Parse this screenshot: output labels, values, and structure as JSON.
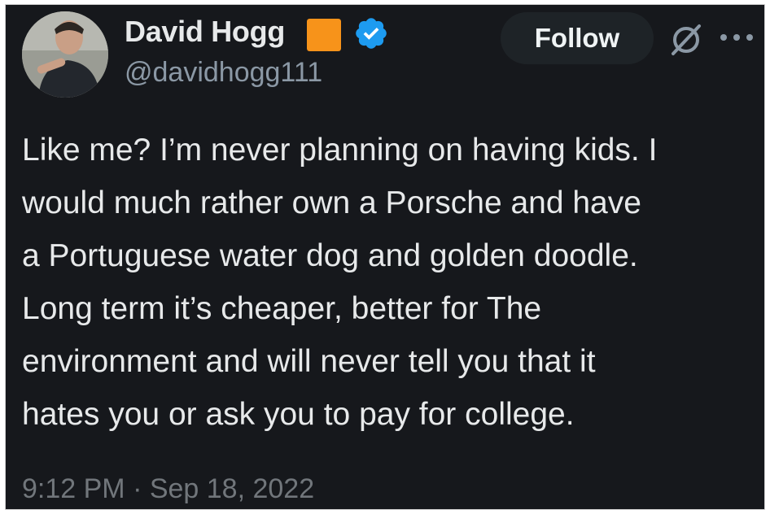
{
  "tweet": {
    "author": {
      "display_name": "David Hogg",
      "handle": "@davidhogg111",
      "avatar": "avatar-photo",
      "badges": [
        "orange-square-icon",
        "verified-icon"
      ]
    },
    "header": {
      "follow_label": "Follow",
      "grok_icon": "grok-icon",
      "more_icon": "more-icon"
    },
    "text_lines": [
      "Like me? I’m never planning on having kids. I",
      "would much rather own a Porsche and have",
      "a Portuguese water dog and golden doodle.",
      "Long term it’s cheaper, better for The",
      "environment and will never tell you that it",
      "hates you or ask you to pay for college."
    ],
    "timestamp": "9:12 PM · Sep 18, 2022"
  },
  "colors": {
    "background": "#16181c",
    "text": "#e7e9ea",
    "secondary_text": "#71767b",
    "verified_blue": "#1d9bf0",
    "badge_orange": "#f7931a",
    "follow_button_bg": "#1e2327"
  }
}
